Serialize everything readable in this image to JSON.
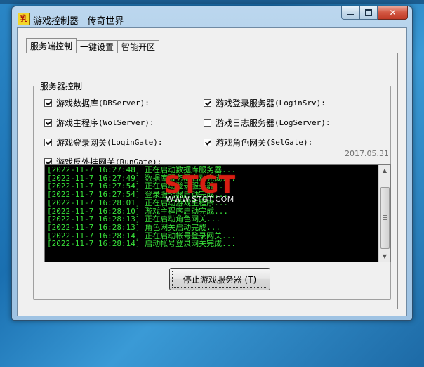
{
  "window": {
    "title": "游戏控制器   传奇世界",
    "app_icon_glyph": "乳",
    "close_glyph": "✕"
  },
  "tabs": [
    {
      "label": "服务端控制",
      "active": true
    },
    {
      "label": "一键设置",
      "active": false
    },
    {
      "label": "智能开区",
      "active": false
    }
  ],
  "server_group": {
    "title": "服务器控制",
    "checkboxes": [
      {
        "name": "游戏数据库",
        "code": "(DBServer):",
        "checked": true
      },
      {
        "name": "游戏登录服务器",
        "code": "(LoginSrv):",
        "checked": true
      },
      {
        "name": "游戏主程序",
        "code": "(WolServer):",
        "checked": true
      },
      {
        "name": "游戏日志服务器",
        "code": "(LogServer):",
        "checked": false
      },
      {
        "name": "游戏登录网关",
        "code": "(LoginGate):",
        "checked": true
      },
      {
        "name": "游戏角色网关",
        "code": "(SelGate):",
        "checked": true
      },
      {
        "name": "游戏反外挂网关",
        "code": "(RunGate):",
        "checked": true
      }
    ],
    "date": "2017.05.31"
  },
  "log": [
    "[2022-11-7 16:27:48] 正在启动数据库服务器...",
    "[2022-11-7 16:27:49] 数据库服务器启动完成...",
    "[2022-11-7 16:27:54] 正在启动登录服务器...",
    "[2022-11-7 16:27:54] 登录服务器启动完成...",
    "[2022-11-7 16:28:01] 正在启动游戏主程序...",
    "[2022-11-7 16:28:10] 游戏主程序启动完成...",
    "[2022-11-7 16:28:13] 正在启动角色网关...",
    "[2022-11-7 16:28:13] 角色网关启动完成...",
    "[2022-11-7 16:28:14] 正在启动帐号登录网关...",
    "[2022-11-7 16:28:14] 启动帐号登录网关完成..."
  ],
  "watermark": {
    "big": "STGT",
    "small": "WWW.STGT.COM"
  },
  "stop_button": {
    "label": "停止游戏服务器 (T)"
  }
}
